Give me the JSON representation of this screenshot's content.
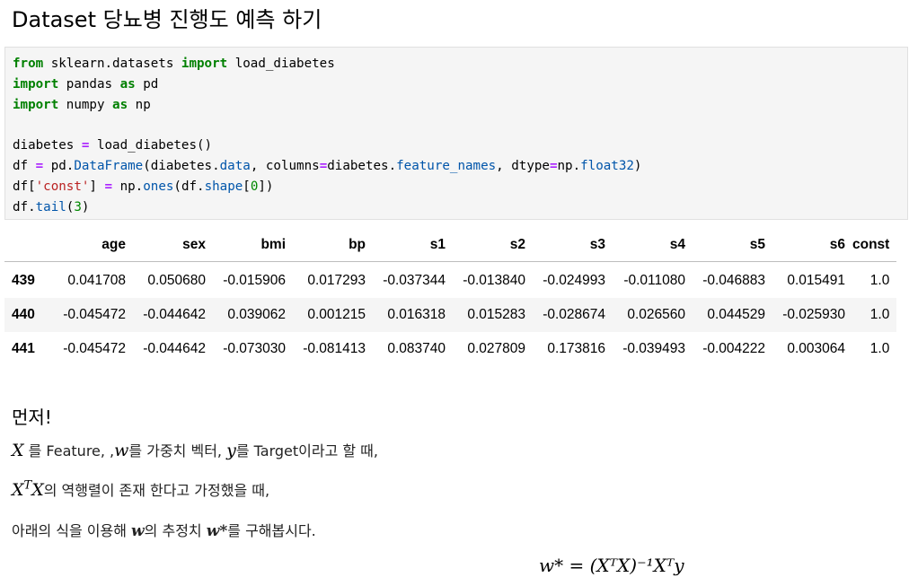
{
  "heading": "Dataset 당뇨병 진행도 예측 하기",
  "code_lines": [
    "from sklearn.datasets import load_diabetes",
    "import pandas as pd",
    "import numpy as np",
    "",
    "diabetes = load_diabetes()",
    "df = pd.DataFrame(diabetes.data, columns=diabetes.feature_names, dtype=np.float32)",
    "df['const'] = np.ones(df.shape[0])",
    "df.tail(3)"
  ],
  "table": {
    "columns": [
      "age",
      "sex",
      "bmi",
      "bp",
      "s1",
      "s2",
      "s3",
      "s4",
      "s5",
      "s6",
      "const"
    ],
    "rows": [
      {
        "index": "439",
        "values": [
          "0.041708",
          "0.050680",
          "-0.015906",
          "0.017293",
          "-0.037344",
          "-0.013840",
          "-0.024993",
          "-0.011080",
          "-0.046883",
          "0.015491",
          "1.0"
        ]
      },
      {
        "index": "440",
        "values": [
          "-0.045472",
          "-0.044642",
          "0.039062",
          "0.001215",
          "0.016318",
          "0.015283",
          "-0.028674",
          "0.026560",
          "0.044529",
          "-0.025930",
          "1.0"
        ]
      },
      {
        "index": "441",
        "values": [
          "-0.045472",
          "-0.044642",
          "-0.073030",
          "-0.081413",
          "0.083740",
          "0.027809",
          "0.173816",
          "-0.039493",
          "-0.004222",
          "0.003064",
          "1.0"
        ]
      }
    ]
  },
  "markdown": {
    "title": "먼저!",
    "line1": {
      "x": "X",
      "t1": " 를 Feature, ,",
      "w": "w",
      "t2": "를 가중치 벡터, ",
      "y": "y",
      "t3": "를 Target이라고 할 때,"
    },
    "line2": {
      "xt": "X",
      "sup": "T",
      "x": "X",
      "text": "의 역행렬이 존재 한다고 가정했을 때,"
    },
    "line3": {
      "t1": "아래의 식을 이용해 ",
      "w": "w",
      "t2": "의 추정치 ",
      "wstar": "w",
      "star": "*",
      "t3": "를 구해봅시다."
    },
    "formula": "w* = (XᵀX)⁻¹Xᵀy"
  }
}
